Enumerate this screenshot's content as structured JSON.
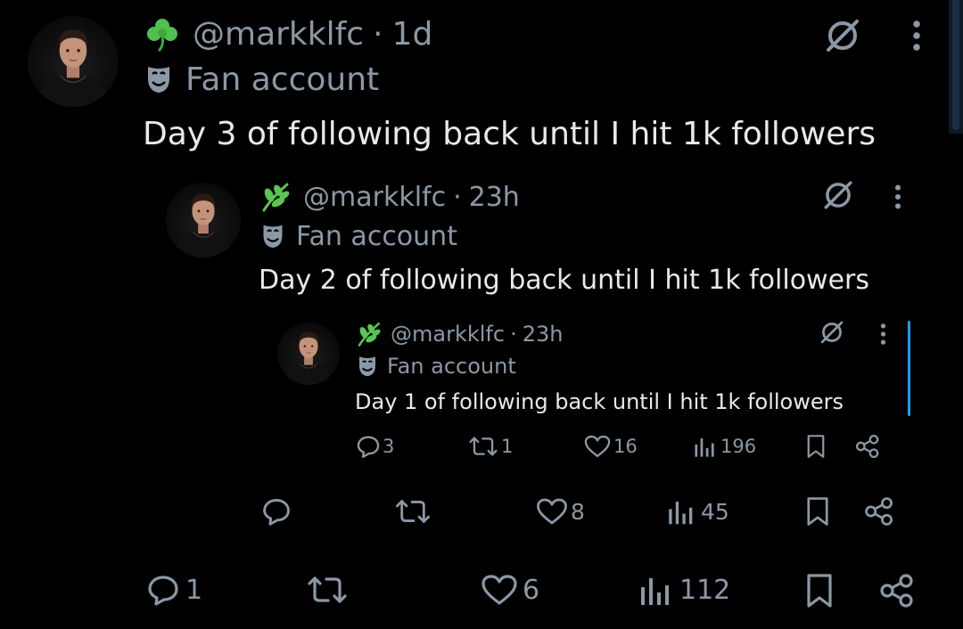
{
  "accent_color": "#1d9bf0",
  "text_color": "#e7e9ea",
  "muted_color": "#8b98a5",
  "tweets": [
    {
      "level": "outer",
      "badge_icon": "shamrock-icon",
      "handle": "@markklfc",
      "separator": "·",
      "time": "1d",
      "account_label_icon": "theater-masks-icon",
      "account_label": "Fan account",
      "text": "Day 3 of following back until I hit 1k followers",
      "replies": "1",
      "reposts": "",
      "likes": "6",
      "views": "112"
    },
    {
      "level": "middle",
      "badge_icon": "herb-icon",
      "handle": "@markklfc",
      "separator": "·",
      "time": "23h",
      "account_label_icon": "theater-masks-icon",
      "account_label": "Fan account",
      "text": "Day 2 of following back until I hit 1k followers",
      "replies": "",
      "reposts": "",
      "likes": "8",
      "views": "45"
    },
    {
      "level": "inner",
      "badge_icon": "herb-icon",
      "handle": "@markklfc",
      "separator": "·",
      "time": "23h",
      "account_label_icon": "theater-masks-icon",
      "account_label": "Fan account",
      "text": "Day 1 of following back until I hit 1k followers",
      "replies": "3",
      "reposts": "1",
      "likes": "16",
      "views": "196"
    }
  ]
}
